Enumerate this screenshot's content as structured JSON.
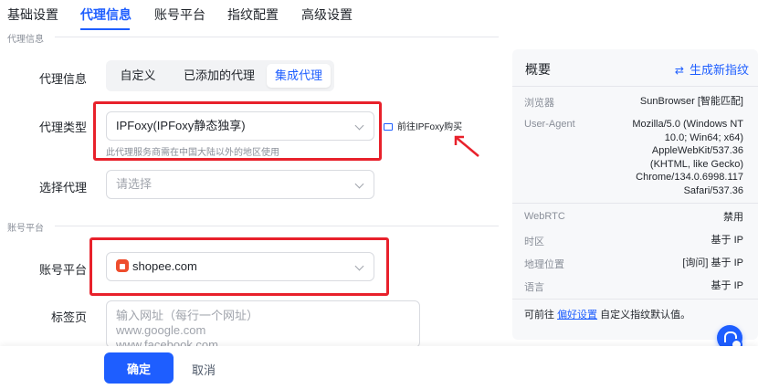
{
  "tabs": [
    {
      "label": "基础设置"
    },
    {
      "label": "代理信息"
    },
    {
      "label": "账号平台"
    },
    {
      "label": "指纹配置"
    },
    {
      "label": "高级设置"
    }
  ],
  "proxy_section": {
    "title": "代理信息",
    "info_label": "代理信息",
    "segments": [
      "自定义",
      "已添加的代理",
      "集成代理"
    ],
    "type_label": "代理类型",
    "type_value": "IPFoxy(IPFoxy静态独享)",
    "type_hint": "此代理服务商需在中国大陆以外的地区使用",
    "buy_link": "前往IPFoxy购买",
    "select_label": "选择代理",
    "select_placeholder": "请选择"
  },
  "account_section": {
    "title": "账号平台",
    "platform_label": "账号平台",
    "platform_value": "shopee.com",
    "tabs_label": "标签页",
    "tabs_placeholder_lines": [
      "输入网址（每行一个网址）",
      "www.google.com",
      "www.facebook.com"
    ]
  },
  "footer": {
    "confirm": "确定",
    "cancel": "取消"
  },
  "overview": {
    "title": "概要",
    "generate": "生成新指纹",
    "rows": [
      {
        "key": "浏览器",
        "value": "SunBrowser [智能匹配]"
      },
      {
        "key": "User-Agent",
        "value_lines": [
          "Mozilla/5.0 (Windows NT",
          "10.0; Win64; x64)",
          "AppleWebKit/537.36",
          "(KHTML, like Gecko)",
          "Chrome/134.0.6998.117",
          "Safari/537.36"
        ]
      },
      {
        "key": "WebRTC",
        "value": "禁用"
      },
      {
        "key": "时区",
        "value": "基于 IP"
      },
      {
        "key": "地理位置",
        "value": "[询问] 基于 IP"
      },
      {
        "key": "语言",
        "value": "基于 IP"
      }
    ],
    "foot_prefix": "可前往",
    "foot_link": "偏好设置",
    "foot_suffix": "自定义指纹默认值。"
  },
  "colors": {
    "accent": "#1e5eff",
    "highlight_red": "#e8212b",
    "shopee": "#ee4d2d"
  },
  "icons": {
    "generate": "shuffle-icon",
    "buy": "card-icon",
    "platform": "shopee-bag-icon",
    "support": "headset-icon",
    "dropdown": "chevron-down-icon"
  }
}
